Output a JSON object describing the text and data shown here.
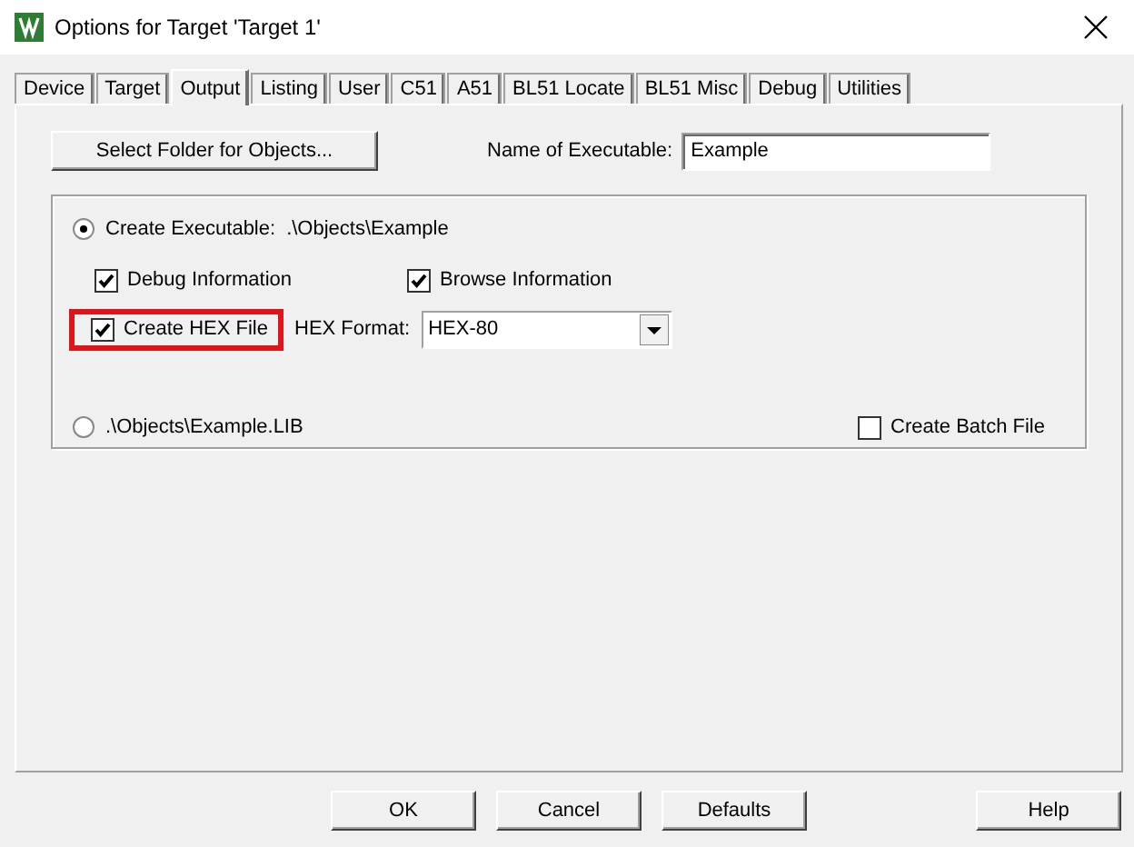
{
  "window": {
    "title": "Options for Target 'Target 1'"
  },
  "tabs": [
    {
      "label": "Device",
      "selected": false
    },
    {
      "label": "Target",
      "selected": false
    },
    {
      "label": "Output",
      "selected": true
    },
    {
      "label": "Listing",
      "selected": false
    },
    {
      "label": "User",
      "selected": false
    },
    {
      "label": "C51",
      "selected": false
    },
    {
      "label": "A51",
      "selected": false
    },
    {
      "label": "BL51 Locate",
      "selected": false
    },
    {
      "label": "BL51 Misc",
      "selected": false
    },
    {
      "label": "Debug",
      "selected": false
    },
    {
      "label": "Utilities",
      "selected": false
    }
  ],
  "select_folder_button": "Select Folder for Objects...",
  "name_of_executable": {
    "label": "Name of Executable:",
    "value": "Example"
  },
  "create_executable": {
    "label": "Create Executable:",
    "path": ".\\Objects\\Example",
    "selected": true
  },
  "debug_information": {
    "label": "Debug Information",
    "checked": true
  },
  "browse_information": {
    "label": "Browse Information",
    "checked": true
  },
  "create_hex_file": {
    "label": "Create HEX File",
    "checked": true,
    "highlighted": true
  },
  "hex_format": {
    "label": "HEX Format:",
    "value": "HEX-80"
  },
  "create_library": {
    "label": ".\\Objects\\Example.LIB",
    "selected": false
  },
  "create_batch_file": {
    "label": "Create Batch File",
    "checked": false
  },
  "buttons": [
    {
      "label": "OK",
      "kind": "left"
    },
    {
      "label": "Cancel",
      "kind": "left"
    },
    {
      "label": "Defaults",
      "kind": "left"
    },
    {
      "label": "Help",
      "kind": "right"
    }
  ]
}
